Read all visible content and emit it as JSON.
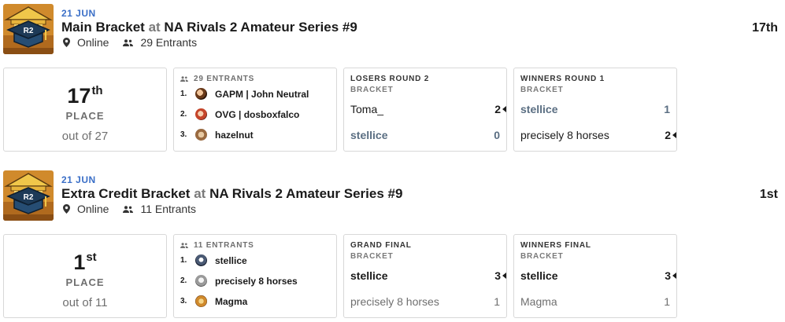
{
  "events": [
    {
      "date": "21 JUN",
      "bracket": "Main Bracket",
      "at": "at",
      "tournament": "NA Rivals 2 Amateur Series #9",
      "location": "Online",
      "entrants_text": "29 Entrants",
      "result": "17th",
      "placing": {
        "number": "17",
        "suffix": "th",
        "label": "PLACE",
        "out_of": "out of 27"
      },
      "entrants_card": {
        "header": "29 ENTRANTS",
        "top": [
          {
            "rank": "1.",
            "name": "GAPM | John Neutral"
          },
          {
            "rank": "2.",
            "name": "OVG | dosboxfalco"
          },
          {
            "rank": "3.",
            "name": "hazelnut"
          }
        ]
      },
      "matches": [
        {
          "round": "LOSERS ROUND 2",
          "sub": "BRACKET",
          "players": [
            {
              "name": "Toma_",
              "score": "2",
              "winner": true
            },
            {
              "name": "stellice",
              "score": "0",
              "winner": false
            }
          ]
        },
        {
          "round": "WINNERS ROUND 1",
          "sub": "BRACKET",
          "players": [
            {
              "name": "stellice",
              "score": "1",
              "winner": false
            },
            {
              "name": "precisely 8 horses",
              "score": "2",
              "winner": true
            }
          ]
        }
      ]
    },
    {
      "date": "21 JUN",
      "bracket": "Extra Credit Bracket",
      "at": "at",
      "tournament": "NA Rivals 2 Amateur Series #9",
      "location": "Online",
      "entrants_text": "11 Entrants",
      "result": "1st",
      "placing": {
        "number": "1",
        "suffix": "st",
        "label": "PLACE",
        "out_of": "out of 11"
      },
      "entrants_card": {
        "header": "11 ENTRANTS",
        "top": [
          {
            "rank": "1.",
            "name": "stellice"
          },
          {
            "rank": "2.",
            "name": "precisely 8 horses"
          },
          {
            "rank": "3.",
            "name": "Magma"
          }
        ]
      },
      "matches": [
        {
          "round": "GRAND FINAL",
          "sub": "BRACKET",
          "players": [
            {
              "name": "stellice",
              "score": "3",
              "winner": true
            },
            {
              "name": "precisely 8 horses",
              "score": "1",
              "winner": false
            }
          ]
        },
        {
          "round": "WINNERS FINAL",
          "sub": "BRACKET",
          "players": [
            {
              "name": "stellice",
              "score": "3",
              "winner": true
            },
            {
              "name": "Magma",
              "score": "1",
              "winner": false
            }
          ]
        }
      ]
    }
  ],
  "icons": {
    "location": "map-pin-icon",
    "entrants": "people-icon",
    "winner_marker": "triangle-left-icon",
    "thumbnail": "tournament-logo"
  },
  "colors": {
    "date_blue": "#3b6fc7",
    "text_dark": "#1a1a1a",
    "text_gray": "#6f6f6f",
    "border": "#d8d8d8"
  }
}
